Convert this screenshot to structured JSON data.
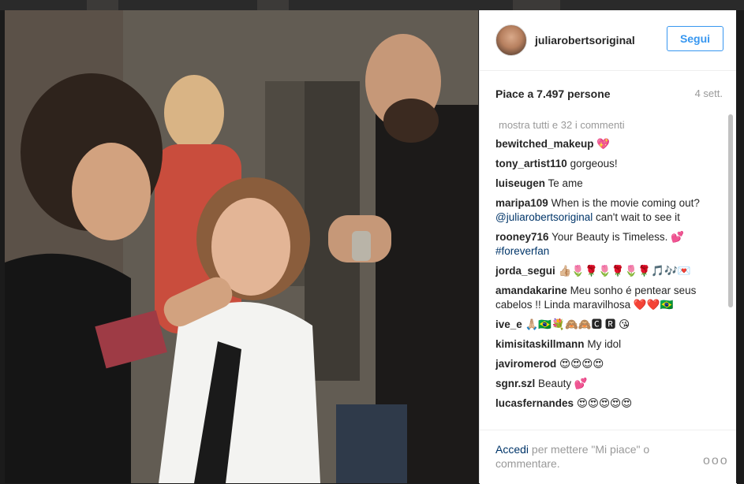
{
  "post": {
    "username": "juliarobertsoriginal",
    "follow_label": "Segui",
    "likes": "Piace a 7.497 persone",
    "time": "4 sett."
  },
  "comments": {
    "show_all": "mostra tutti e 32 i commenti",
    "items": [
      {
        "user": "bewitched_makeup",
        "text": "💖"
      },
      {
        "user": "tony_artist110",
        "text": "gorgeous!"
      },
      {
        "user": "luiseugen",
        "text": "Te ame"
      },
      {
        "user": "maripa109",
        "text": "When is the movie coming out?",
        "mention": "@juliarobertsoriginal",
        "text2": "can't wait to see it"
      },
      {
        "user": "rooney716",
        "text": "Your Beauty is Timeless. 💕",
        "tag": "#foreverfan"
      },
      {
        "user": "jorda_segui",
        "text": "👍🏼🌷🌹🌷🌹🌷🌹🎵🎶💌"
      },
      {
        "user": "amandakarine",
        "text": "Meu sonho é pentear seus cabelos !! Linda maravilhosa ❤️❤️🇧🇷"
      },
      {
        "user": "ive_e",
        "text": "🙏🏼🇧🇷💐🙈🙈🅲 🆁 😘"
      },
      {
        "user": "kimisitaskillmann",
        "text": "My idol"
      },
      {
        "user": "javiromerod",
        "text": "😍😍😍😍"
      },
      {
        "user": "sgnr.szl",
        "text": "Beauty 💕"
      },
      {
        "user": "lucasfernandes",
        "text": "😍😍😍😍😍"
      }
    ]
  },
  "footer": {
    "login_label": "Accedi",
    "rest": "per mettere \"Mi piace\" o commentare.",
    "more_label": "ooo"
  }
}
